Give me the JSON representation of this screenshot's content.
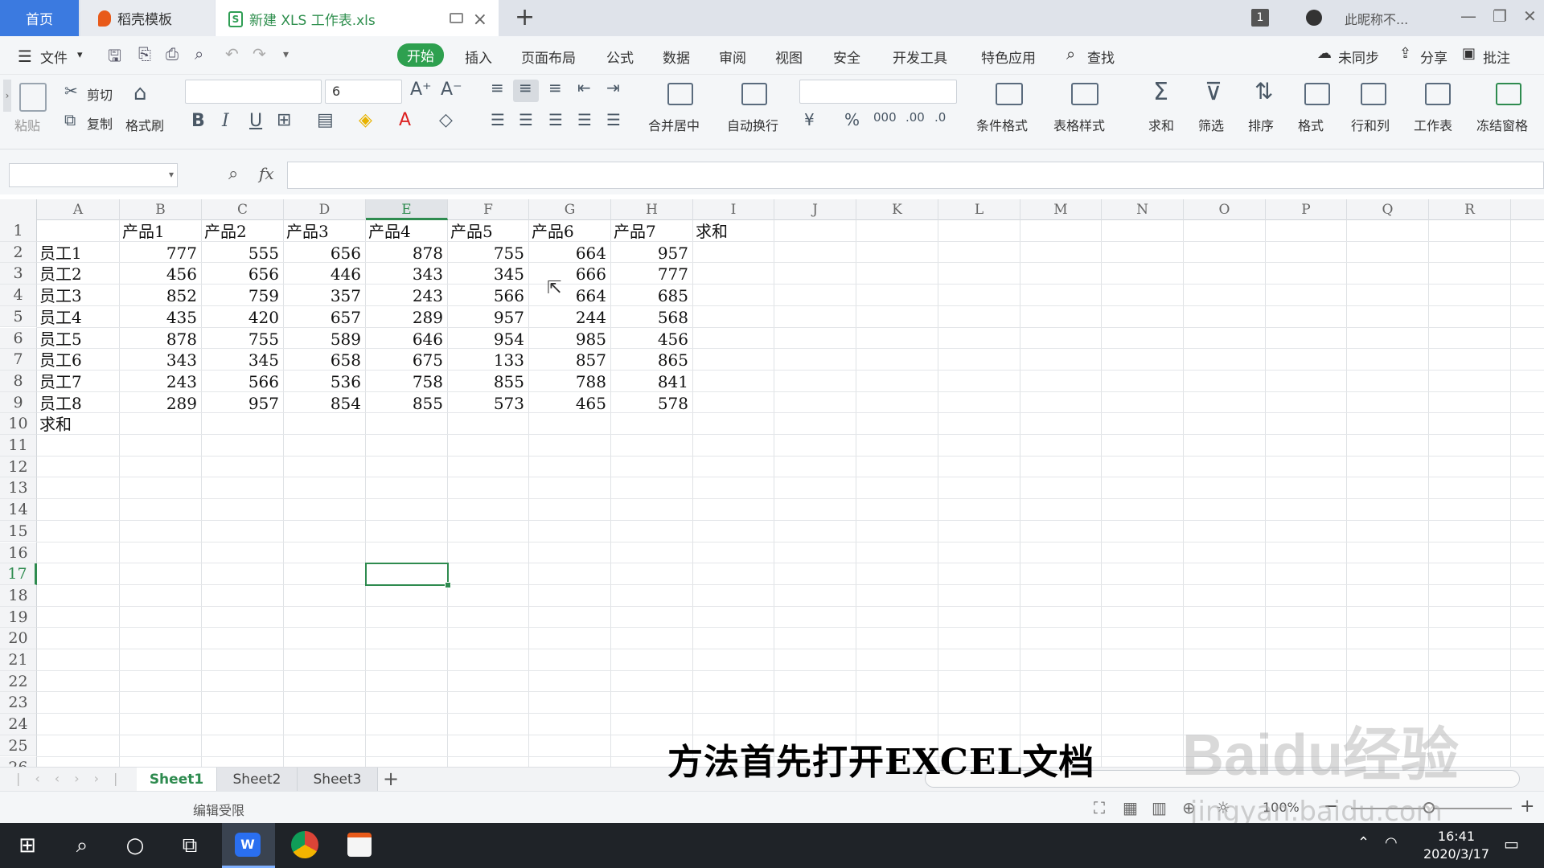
{
  "tabs": {
    "home": "首页",
    "docer": "稻壳模板",
    "doc": "新建 XLS 工作表.xls",
    "new": "+",
    "count": "1",
    "user": "此昵称不..."
  },
  "menu": {
    "file": "文件",
    "items": [
      "开始",
      "插入",
      "页面布局",
      "公式",
      "数据",
      "审阅",
      "视图",
      "安全",
      "开发工具",
      "特色应用"
    ],
    "search": "查找",
    "sync": "未同步",
    "share": "分享",
    "comment": "批注"
  },
  "ribbon": {
    "paste": "粘贴",
    "cut": "剪切",
    "copy": "复制",
    "format_painter": "格式刷",
    "font_size": "6",
    "merge": "合并居中",
    "wrap": "自动换行",
    "cond_format": "条件格式",
    "table_style": "表格样式",
    "sum": "求和",
    "filter": "筛选",
    "sort": "排序",
    "format": "格式",
    "rowcol": "行和列",
    "sheet": "工作表",
    "freeze": "冻结窗格",
    "bold": "B",
    "italic": "I",
    "underline": "U",
    "percent": "%"
  },
  "formula": {
    "fx": "fx",
    "value": ""
  },
  "columns": [
    "A",
    "B",
    "C",
    "D",
    "E",
    "F",
    "G",
    "H",
    "I",
    "J",
    "K",
    "L",
    "M",
    "N",
    "O",
    "P",
    "Q",
    "R"
  ],
  "rows": [
    "1",
    "2",
    "3",
    "4",
    "5",
    "6",
    "7",
    "8",
    "9",
    "10",
    "11",
    "12",
    "13",
    "14",
    "15",
    "16",
    "17",
    "18",
    "19",
    "20",
    "21",
    "22",
    "23",
    "24",
    "25",
    "26"
  ],
  "header_row": [
    "产品1",
    "产品2",
    "产品3",
    "产品4",
    "产品5",
    "产品6",
    "产品7",
    "求和"
  ],
  "data_rows": [
    {
      "name": "员工1",
      "values": [
        "777",
        "555",
        "656",
        "878",
        "755",
        "664",
        "957"
      ]
    },
    {
      "name": "员工2",
      "values": [
        "456",
        "656",
        "446",
        "343",
        "345",
        "666",
        "777"
      ]
    },
    {
      "name": "员工3",
      "values": [
        "852",
        "759",
        "357",
        "243",
        "566",
        "664",
        "685"
      ]
    },
    {
      "name": "员工4",
      "values": [
        "435",
        "420",
        "657",
        "289",
        "957",
        "244",
        "568"
      ]
    },
    {
      "name": "员工5",
      "values": [
        "878",
        "755",
        "589",
        "646",
        "954",
        "985",
        "456"
      ]
    },
    {
      "name": "员工6",
      "values": [
        "343",
        "345",
        "658",
        "675",
        "133",
        "857",
        "865"
      ]
    },
    {
      "name": "员工7",
      "values": [
        "243",
        "566",
        "536",
        "758",
        "855",
        "788",
        "841"
      ]
    },
    {
      "name": "员工8",
      "values": [
        "289",
        "957",
        "854",
        "855",
        "573",
        "465",
        "578"
      ]
    }
  ],
  "sum_label": "求和",
  "sheets": [
    "Sheet1",
    "Sheet2",
    "Sheet3"
  ],
  "status": {
    "edit": "编辑受限",
    "zoom": "100%"
  },
  "caption": "方法首先打开EXCEL文档",
  "watermark": {
    "main": "Baidu经验",
    "sub": "jingyan.baidu.com"
  },
  "clock": {
    "time": "16:41",
    "date": "2020/3/17"
  },
  "colors": {
    "accent": "#2e8b4f",
    "tab_home": "#3b7ae0",
    "taskbar": "#1f2328"
  }
}
